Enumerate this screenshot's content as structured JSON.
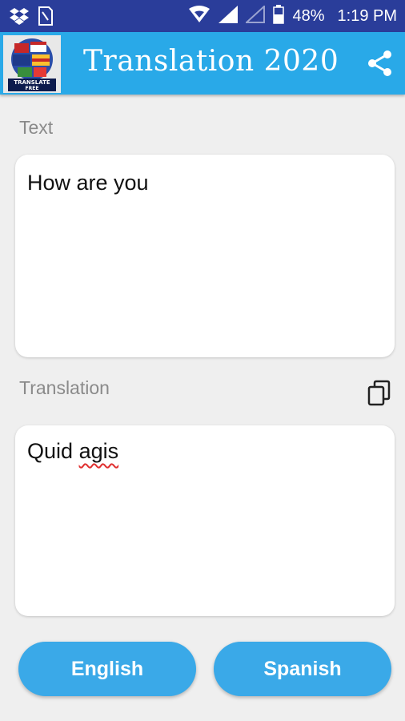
{
  "status_bar": {
    "battery": "48%",
    "time": "1:19 PM",
    "icons": [
      "dropbox-icon",
      "sim-icon",
      "wifi-icon",
      "signal-icon",
      "signal-empty-icon",
      "battery-icon"
    ]
  },
  "app_bar": {
    "title": "Translation 2020",
    "logo_text": "TRANSLATE FREE",
    "share_icon": "share-icon",
    "color": "#29a9e8"
  },
  "input": {
    "label": "Text",
    "value": "How are you"
  },
  "output": {
    "label": "Translation",
    "value_word1": "Quid",
    "value_word2": "agis",
    "copy_icon": "copy-icon"
  },
  "buttons": {
    "source_language": "English",
    "target_language": "Spanish",
    "color": "#3aa9e8"
  }
}
